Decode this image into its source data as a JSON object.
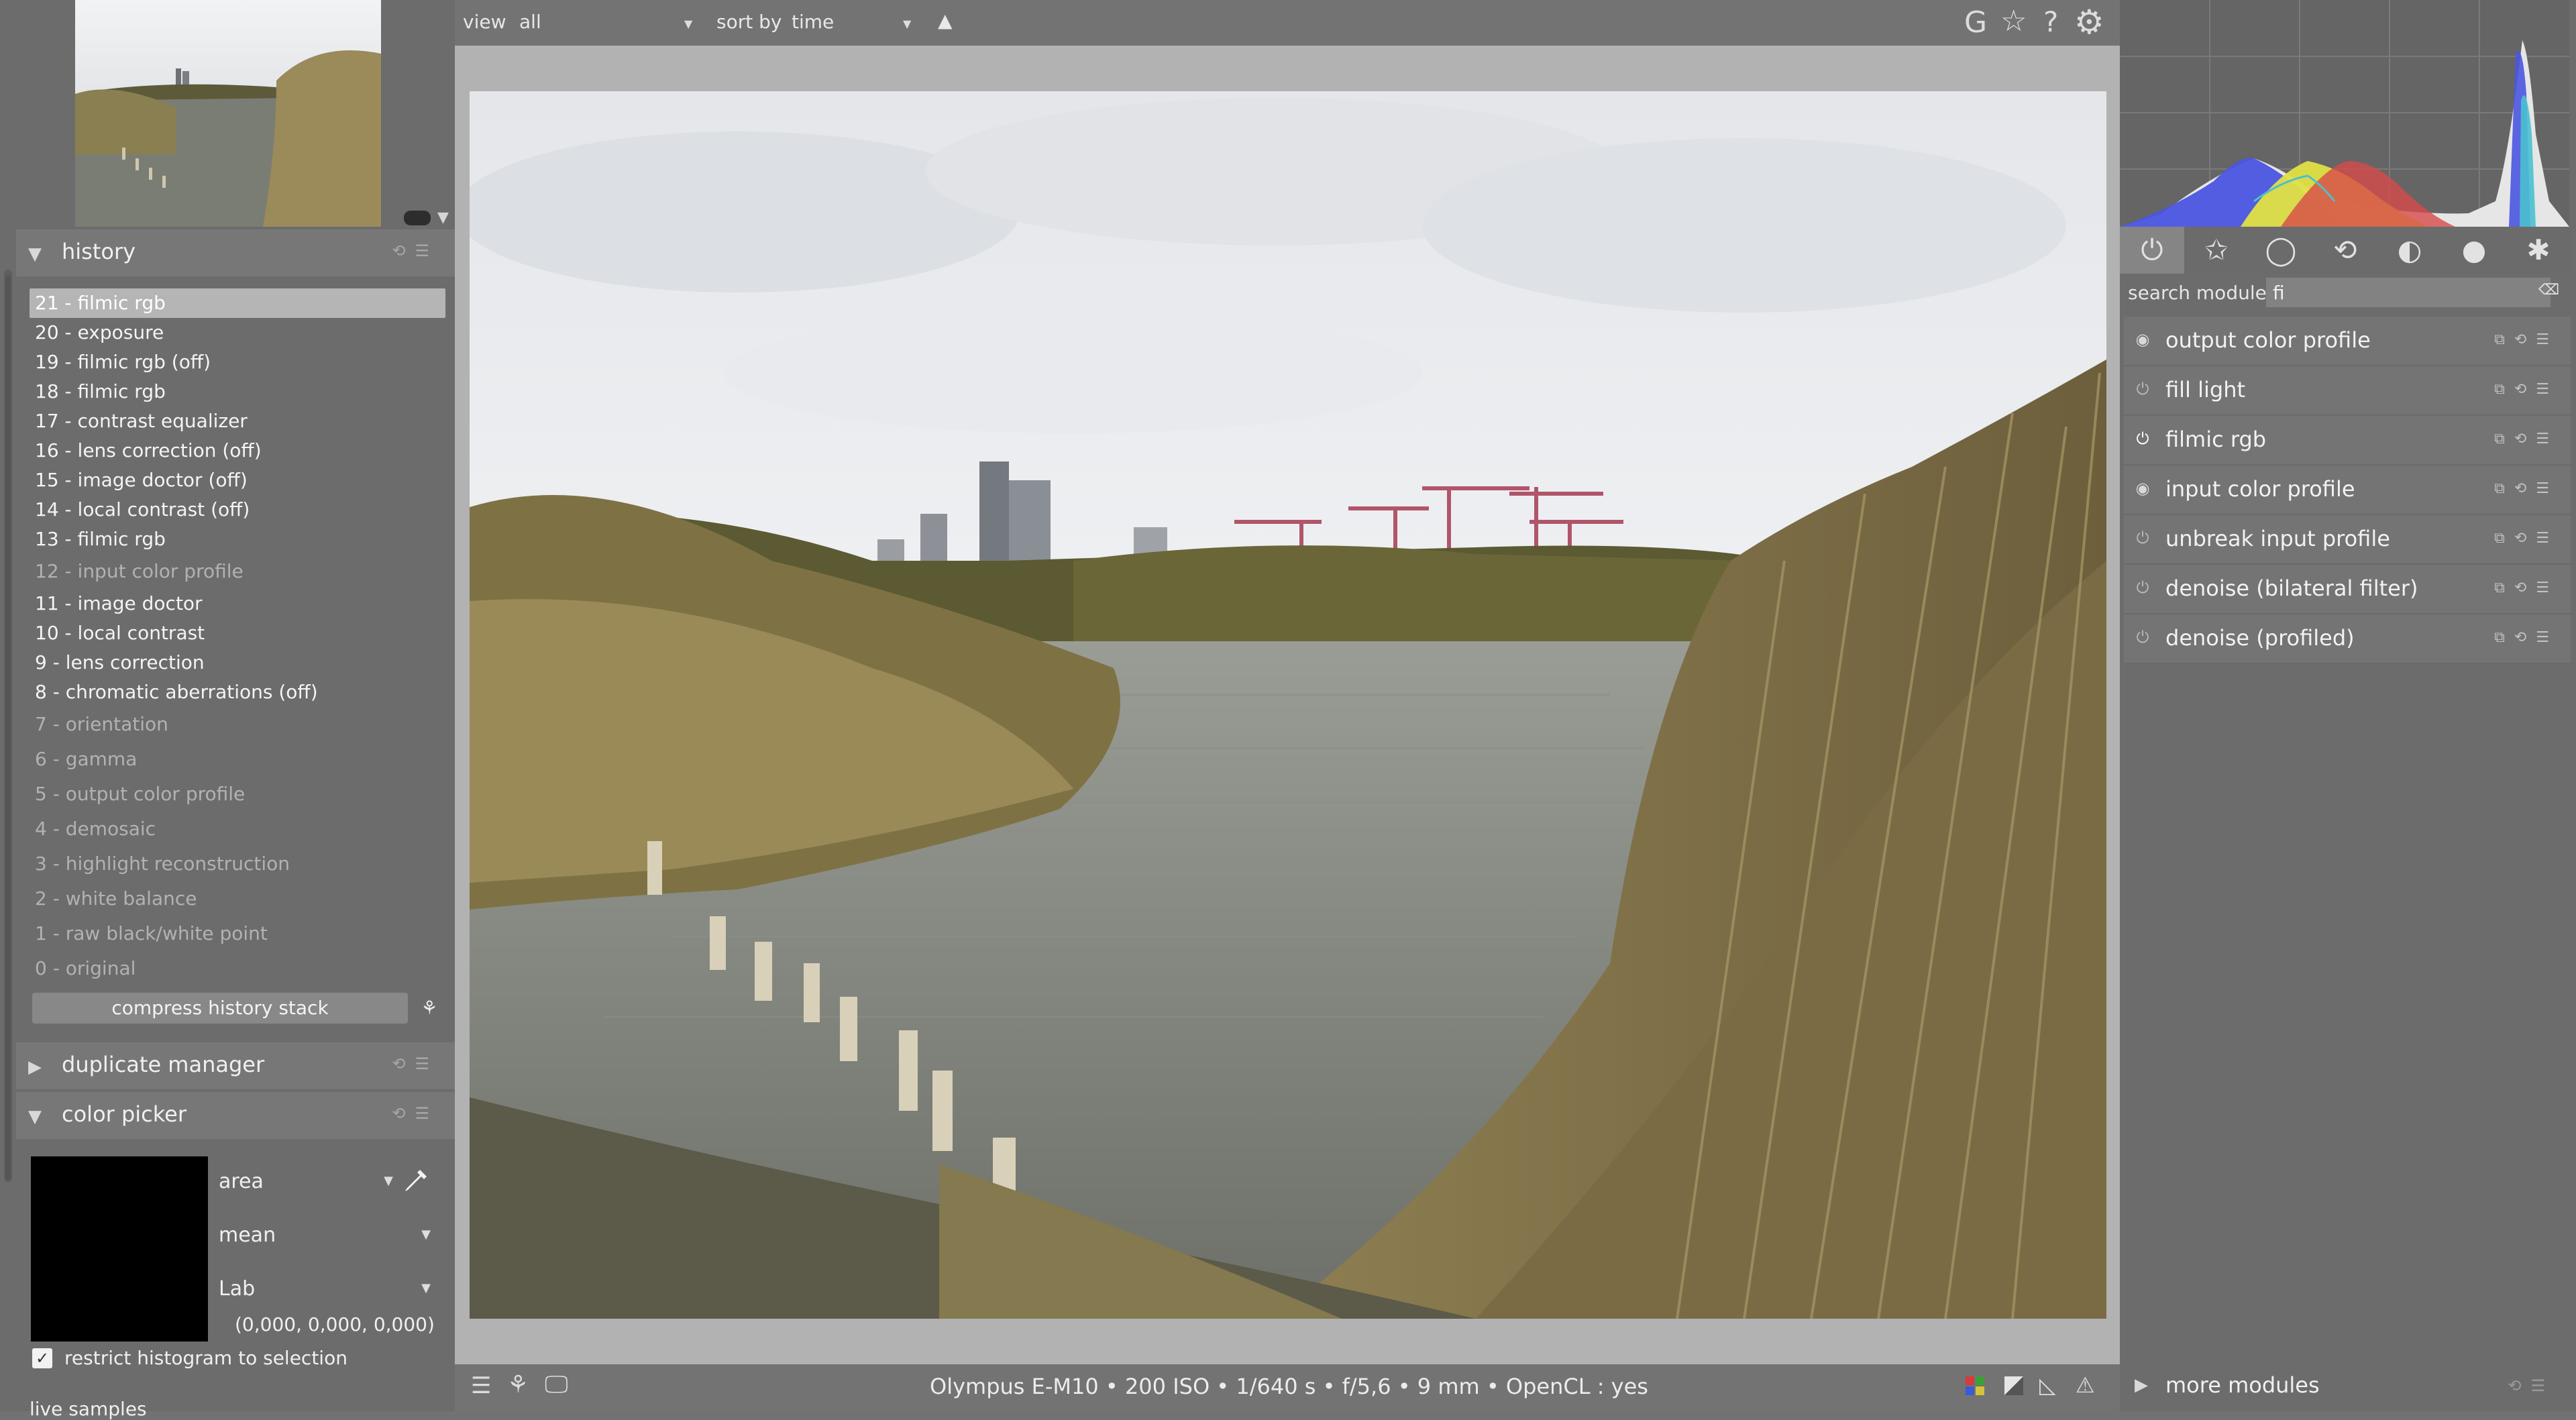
{
  "left": {
    "history": {
      "title": "history",
      "items": [
        {
          "label": "21 - filmic rgb",
          "state": "selected"
        },
        {
          "label": "20 - exposure",
          "state": "normal"
        },
        {
          "label": "19 - filmic rgb (off)",
          "state": "normal"
        },
        {
          "label": "18 - filmic rgb",
          "state": "normal"
        },
        {
          "label": "17 - contrast equalizer",
          "state": "normal"
        },
        {
          "label": "16 - lens correction (off)",
          "state": "normal"
        },
        {
          "label": "15 - image doctor (off)",
          "state": "normal"
        },
        {
          "label": "14 - local contrast (off)",
          "state": "normal"
        },
        {
          "label": "13 - filmic rgb",
          "state": "normal"
        },
        {
          "label": "12 - input color profile",
          "state": "dim"
        },
        {
          "label": "11 - image doctor",
          "state": "normal"
        },
        {
          "label": "10 - local contrast",
          "state": "normal"
        },
        {
          "label": "9 - lens correction",
          "state": "normal"
        },
        {
          "label": "8 - chromatic aberrations (off)",
          "state": "normal"
        },
        {
          "label": "7 - orientation",
          "state": "dim"
        },
        {
          "label": "6 - gamma",
          "state": "dim"
        },
        {
          "label": "5 - output color profile",
          "state": "dim"
        },
        {
          "label": "4 - demosaic",
          "state": "dim"
        },
        {
          "label": "3 - highlight reconstruction",
          "state": "dim"
        },
        {
          "label": "2 - white balance",
          "state": "dim"
        },
        {
          "label": "1 - raw black/white point",
          "state": "dim"
        },
        {
          "label": "0 - original",
          "state": "dim"
        }
      ],
      "compress_label": "compress history stack"
    },
    "duplicate_manager": {
      "title": "duplicate manager"
    },
    "color_picker": {
      "title": "color picker",
      "mode": "area",
      "statistic": "mean",
      "colorspace": "Lab",
      "values": "(0,000, 0,000, 0,000)",
      "restrict_label": "restrict histogram to selection",
      "restrict_checked": true,
      "live_samples_label": "live samples"
    }
  },
  "top": {
    "view_label": "view",
    "view_value": "all",
    "sort_label": "sort by",
    "sort_value": "time",
    "sort_direction_icon": "▲",
    "right_icons": [
      "G",
      "☆",
      "?",
      "⚙"
    ]
  },
  "bottom": {
    "status": "Olympus E-M10 •  200 ISO • 1/640 s • f/5,6 • 9 mm  • OpenCL : yes"
  },
  "right": {
    "search_label": "search module",
    "search_value": "fi",
    "modules": [
      {
        "name": "output color profile",
        "power": "on"
      },
      {
        "name": "fill light",
        "power": "off"
      },
      {
        "name": "filmic rgb",
        "power": "on-bold"
      },
      {
        "name": "input color profile",
        "power": "on"
      },
      {
        "name": "unbreak input profile",
        "power": "off"
      },
      {
        "name": "denoise (bilateral filter)",
        "power": "off"
      },
      {
        "name": "denoise (profiled)",
        "power": "off"
      }
    ],
    "more_modules_label": "more modules"
  }
}
